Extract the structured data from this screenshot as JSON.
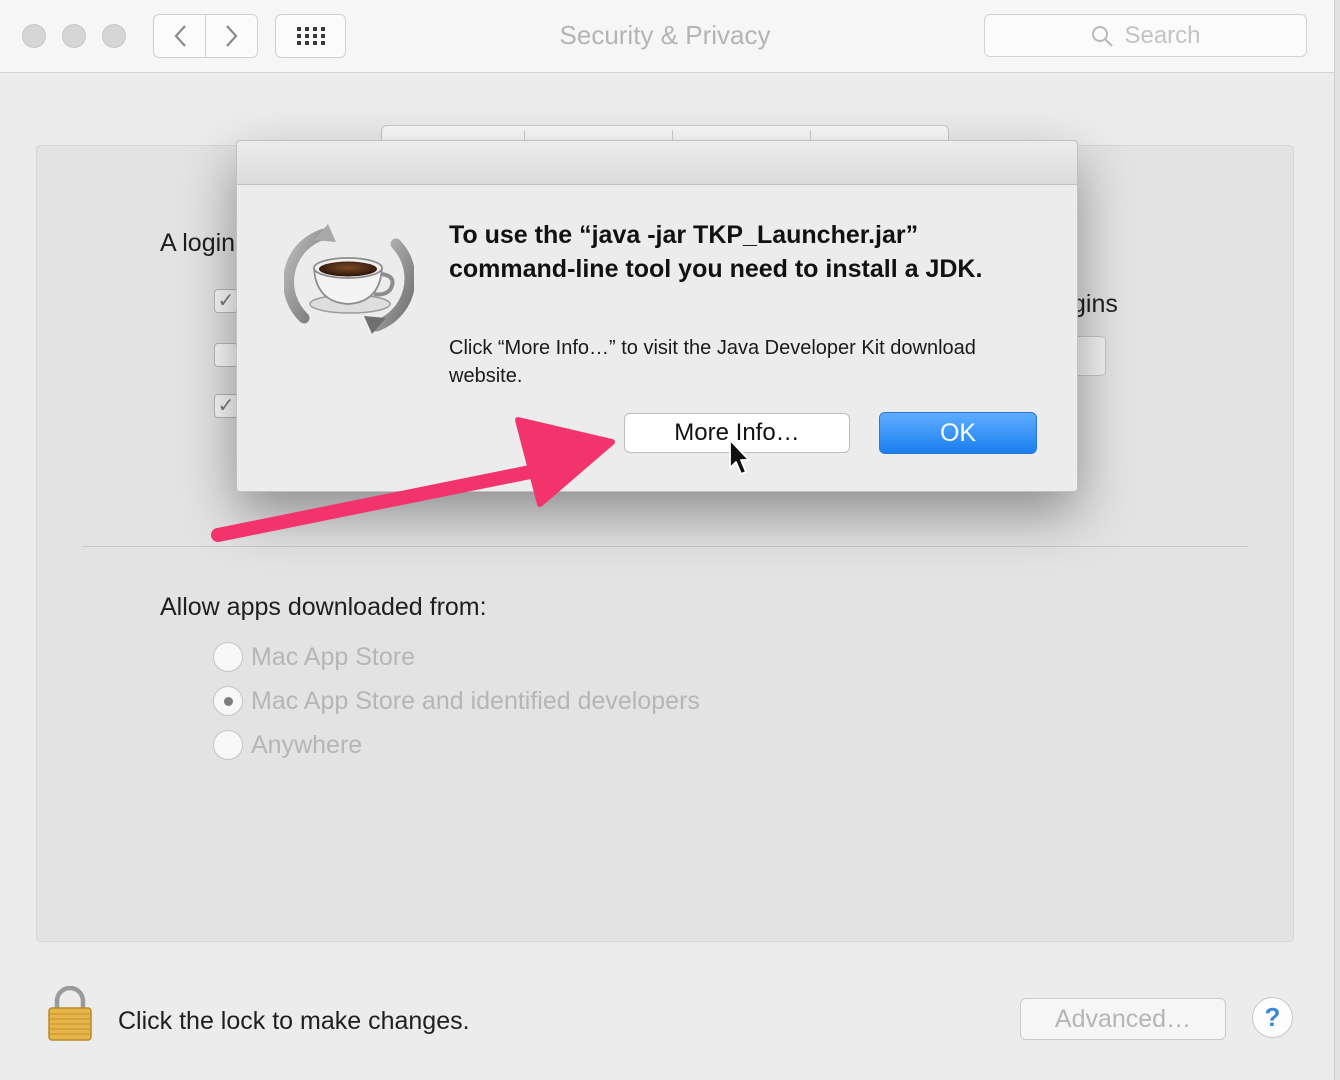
{
  "window": {
    "title": "Security & Privacy",
    "search_placeholder": "Search"
  },
  "background": {
    "login_label_partial": "A login",
    "plugins_partial": "gins",
    "checkboxes": [
      "✓",
      "",
      "✓"
    ],
    "allow_heading": "Allow apps downloaded from:",
    "radio_options": [
      {
        "label": "Mac App Store",
        "selected": false
      },
      {
        "label": "Mac App Store and identified developers",
        "selected": true
      },
      {
        "label": "Anywhere",
        "selected": false
      }
    ],
    "lock_text": "Click the lock to make changes.",
    "advanced_label": "Advanced…",
    "help_label": "?"
  },
  "dialog": {
    "icon": "java-coffee-cup-icon",
    "title": "To use the “java -jar TKP_Launcher.jar” command-line tool you need to install a JDK.",
    "message": "Click “More Info…” to visit the Java Developer Kit download website.",
    "more_info_label": "More Info…",
    "ok_label": "OK"
  },
  "colors": {
    "accent_blue": "#1a7ff0",
    "annotation_arrow": "#f2336c",
    "lock_gold": "#e7b44b"
  }
}
